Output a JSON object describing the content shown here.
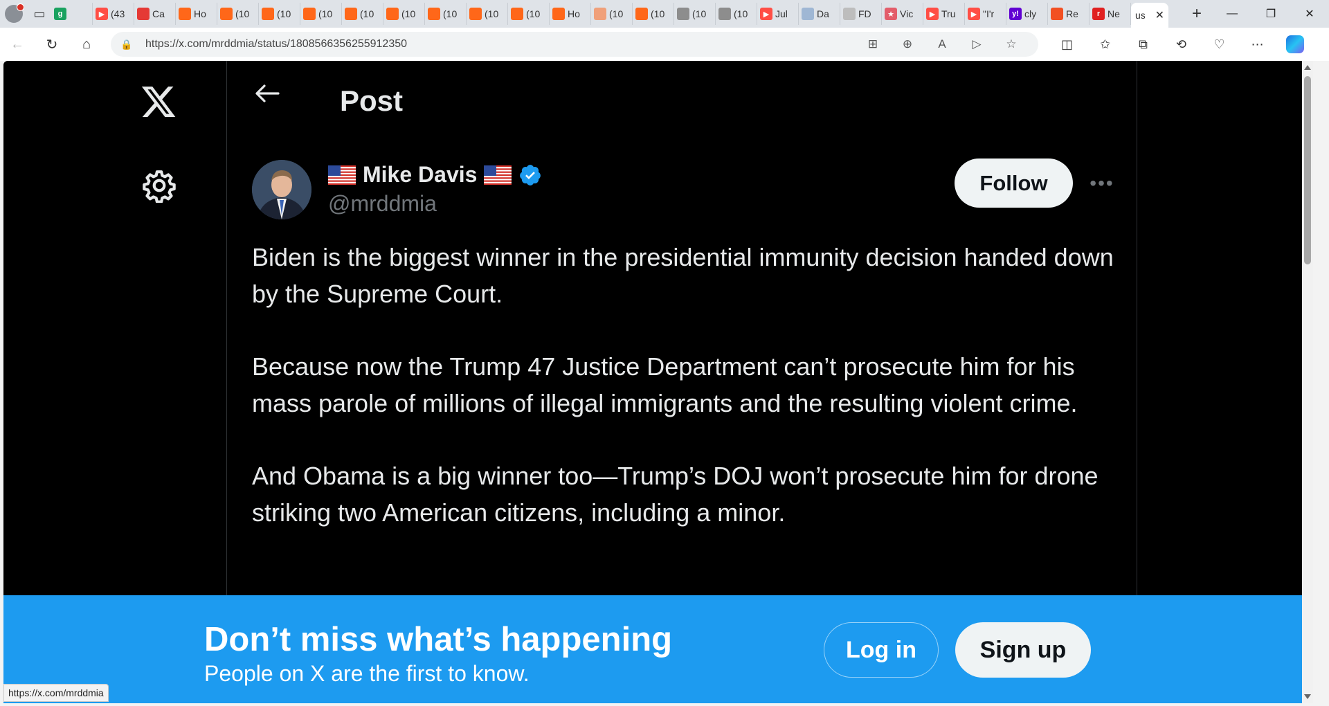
{
  "browser": {
    "tabs": [
      {
        "label": "",
        "color": "#1aa260",
        "glyph": "g"
      },
      {
        "label": "(43",
        "color": "#ff4e45",
        "glyph": "▶"
      },
      {
        "label": "Ca",
        "color": "#e53935",
        "glyph": ""
      },
      {
        "label": "Ho",
        "color": "#ff6719",
        "glyph": ""
      },
      {
        "label": "(10",
        "color": "#ff6719",
        "glyph": ""
      },
      {
        "label": "(10",
        "color": "#ff6719",
        "glyph": ""
      },
      {
        "label": "(10",
        "color": "#ff6719",
        "glyph": ""
      },
      {
        "label": "(10",
        "color": "#ff6719",
        "glyph": ""
      },
      {
        "label": "(10",
        "color": "#ff6719",
        "glyph": ""
      },
      {
        "label": "(10",
        "color": "#ff6719",
        "glyph": ""
      },
      {
        "label": "(10",
        "color": "#ff6719",
        "glyph": ""
      },
      {
        "label": "(10",
        "color": "#ff6719",
        "glyph": ""
      },
      {
        "label": "Ho",
        "color": "#ff6719",
        "glyph": ""
      },
      {
        "label": "(10",
        "color": "#f0a07a",
        "glyph": ""
      },
      {
        "label": "(10",
        "color": "#ff6719",
        "glyph": ""
      },
      {
        "label": "(10",
        "color": "#8d8d8d",
        "glyph": ""
      },
      {
        "label": "(10",
        "color": "#8d8d8d",
        "glyph": ""
      },
      {
        "label": "Jul",
        "color": "#ff4e45",
        "glyph": "▶"
      },
      {
        "label": "Da",
        "color": "#9fb7d4",
        "glyph": ""
      },
      {
        "label": "FD",
        "color": "#bdbdbd",
        "glyph": ""
      },
      {
        "label": "Vic",
        "color": "#e35d6a",
        "glyph": "★"
      },
      {
        "label": "Tru",
        "color": "#ff4e45",
        "glyph": "▶"
      },
      {
        "label": "\"I'r",
        "color": "#ff4e45",
        "glyph": "▶"
      },
      {
        "label": "cly",
        "color": "#6001d2",
        "glyph": "y!"
      },
      {
        "label": "Re",
        "color": "#f25022",
        "glyph": ""
      },
      {
        "label": "Ne",
        "color": "#e02020",
        "glyph": "r"
      }
    ],
    "active_tab": {
      "label": "us"
    },
    "url": "https://x.com/mrddmia/status/1808566356255912350",
    "status_url": "https://x.com/mrddmia"
  },
  "colors": {
    "accent": "#1d9bf0",
    "page_bg": "#000000",
    "text_primary": "#e7e9ea",
    "text_secondary": "#71767b"
  },
  "page": {
    "header_title": "Post",
    "author": {
      "name": "Mike Davis",
      "handle": "@mrddmia",
      "verified": true
    },
    "follow_label": "Follow",
    "more_label": "•••",
    "tweet_paragraphs": [
      "Biden is the biggest winner in the presidential immunity decision handed down by the Supreme Court.",
      "Because now the Trump 47 Justice Department can’t prosecute him for his mass parole of millions of illegal immigrants and the resulting violent crime.",
      "And Obama is a big winner too—Trump’s DOJ won’t prosecute him for drone striking two American citizens, including a minor."
    ]
  },
  "banner": {
    "headline": "Don’t miss what’s happening",
    "subtext": "People on X are the first to know.",
    "login_label": "Log in",
    "signup_label": "Sign up"
  }
}
